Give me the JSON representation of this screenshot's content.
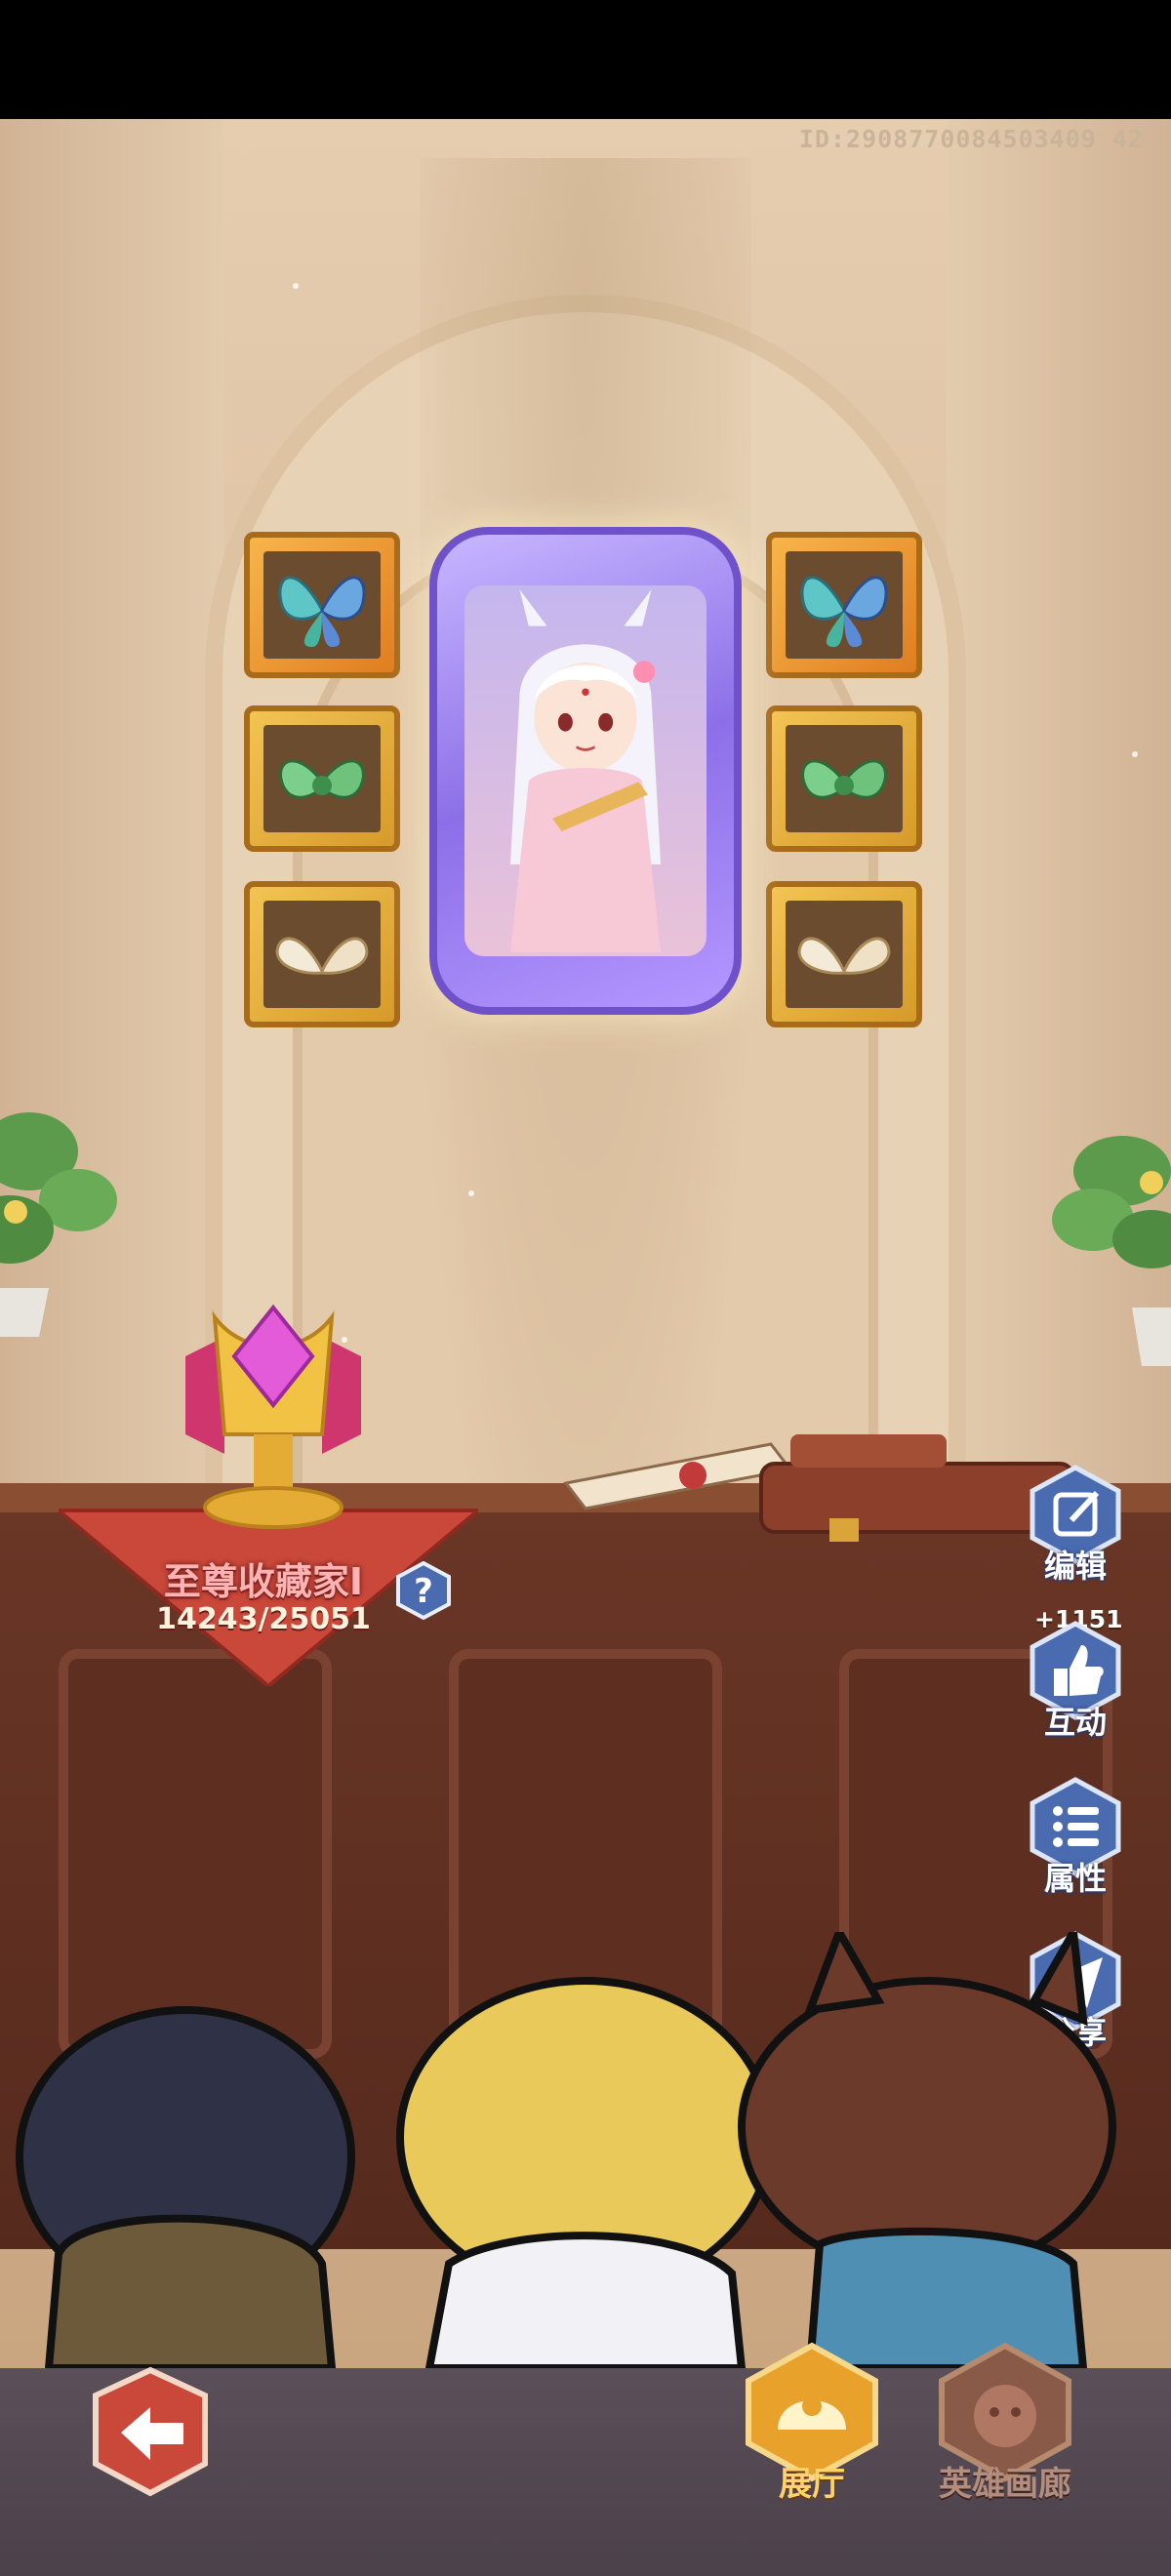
{
  "player_id": "ID:2908770084503409 42",
  "collection": {
    "title": "至尊收藏家I",
    "progress": "14243/25051"
  },
  "side_menu": {
    "edit_label": "编辑",
    "interact_label": "互动",
    "like_count": "+1151",
    "attributes_label": "属性",
    "share_label": "分享"
  },
  "bottom_nav": {
    "hall_label": "展厅",
    "hero_gallery_label": "英雄画廊"
  },
  "colors": {
    "accent_gold": "#f0b438",
    "side_button_blue": "#4a6bb0",
    "banner_red": "#c9483a"
  }
}
